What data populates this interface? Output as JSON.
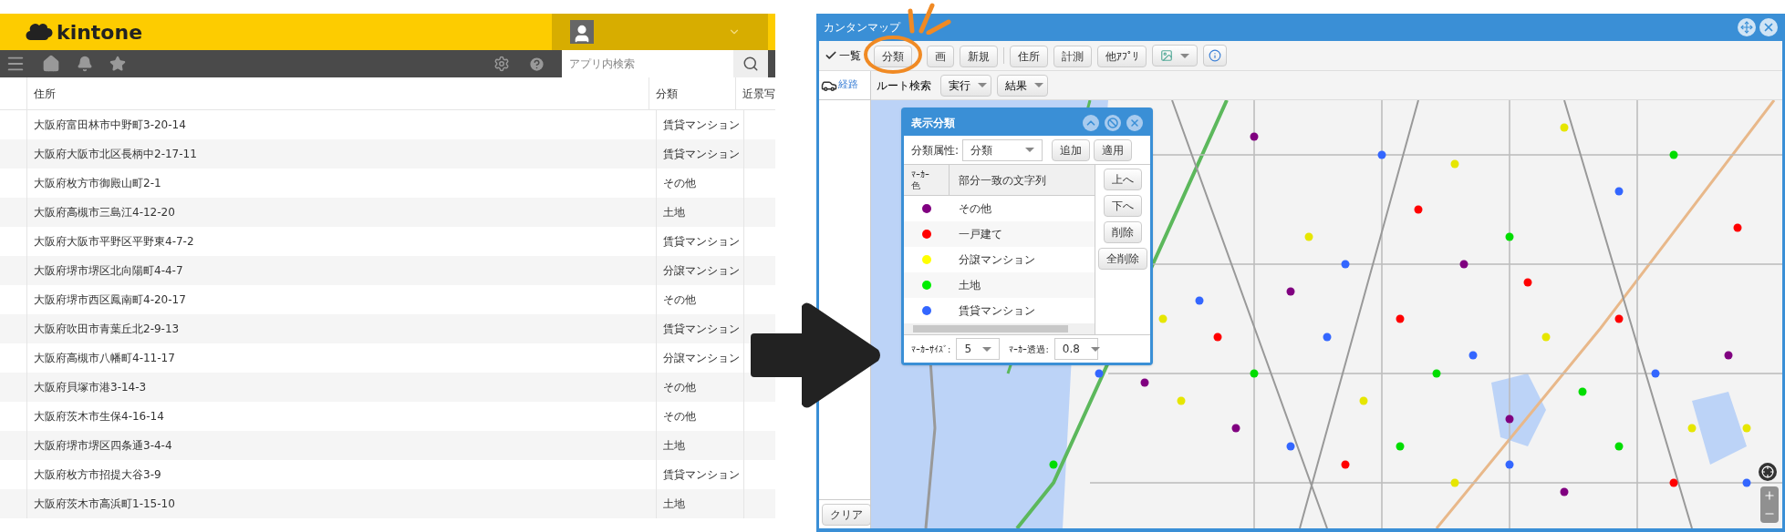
{
  "kintone": {
    "logo": "kintone",
    "search": {
      "placeholder": "アプリ内検索"
    },
    "table": {
      "columns": [
        "住所",
        "分類",
        "近景写"
      ],
      "rows": [
        {
          "address": "大阪府富田林市中野町3-20-14",
          "category": "賃貸マンション"
        },
        {
          "address": "大阪府大阪市北区長柄中2-17-11",
          "category": "賃貸マンション"
        },
        {
          "address": "大阪府枚方市御殿山町2-1",
          "category": "その他"
        },
        {
          "address": "大阪府高槻市三島江4-12-20",
          "category": "土地"
        },
        {
          "address": "大阪府大阪市平野区平野東4-7-2",
          "category": "賃貸マンション"
        },
        {
          "address": "大阪府堺市堺区北向陽町4-4-7",
          "category": "分譲マンション"
        },
        {
          "address": "大阪府堺市西区鳳南町4-20-17",
          "category": "その他"
        },
        {
          "address": "大阪府吹田市青葉丘北2-9-13",
          "category": "賃貸マンション"
        },
        {
          "address": "大阪府高槻市八幡町4-11-17",
          "category": "分譲マンション"
        },
        {
          "address": "大阪府貝塚市港3-14-3",
          "category": "その他"
        },
        {
          "address": "大阪府茨木市生保4-16-14",
          "category": "その他"
        },
        {
          "address": "大阪府堺市堺区四条通3-4-4",
          "category": "土地"
        },
        {
          "address": "大阪府枚方市招提大谷3-9",
          "category": "賃貸マンション"
        },
        {
          "address": "大阪府茨木市高浜町1-15-10",
          "category": "土地"
        }
      ]
    }
  },
  "map_window": {
    "title": "カンタンマップ",
    "toolbar": {
      "list_toggle": {
        "label": "一覧",
        "checked": true
      },
      "buttons": [
        "分類",
        "画",
        "新規",
        "住所",
        "計測",
        "他ｱﾌﾟﾘ"
      ]
    },
    "side_tab": "経路",
    "clear_button": "クリア",
    "route": {
      "label": "ルート検索",
      "buttons": [
        "実行",
        "結果"
      ]
    },
    "dialog": {
      "title": "表示分類",
      "attribute_label": "分類属性:",
      "attribute_value": "分類",
      "buttons": [
        "追加",
        "適用"
      ],
      "columns": [
        "ﾏｰｶｰ色",
        "部分一致の文字列"
      ],
      "rows": [
        {
          "color": "#800080",
          "text": "その他"
        },
        {
          "color": "#ff0000",
          "text": "一戸建て"
        },
        {
          "color": "#ffff00",
          "text": "分譲マンション"
        },
        {
          "color": "#00ee00",
          "text": "土地"
        },
        {
          "color": "#3366ff",
          "text": "賃貸マンション"
        }
      ],
      "side_buttons": [
        "上へ",
        "下へ",
        "削除",
        "全削除"
      ],
      "marker_size_label": "ﾏｰｶｰｻｲｽﾞ:",
      "marker_size": "5",
      "opacity_label": "ﾏｰｶｰ透過:",
      "opacity": "0.8"
    }
  }
}
